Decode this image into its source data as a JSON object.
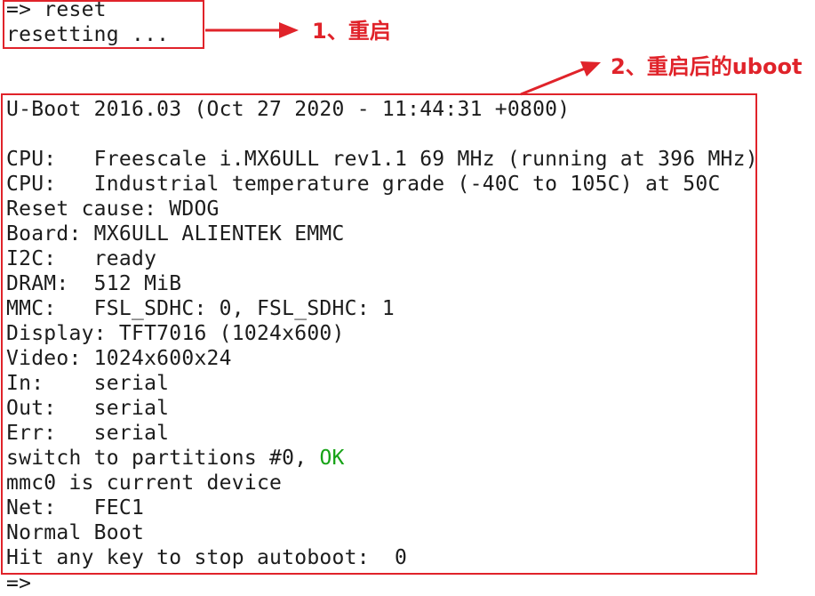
{
  "terminal": {
    "pre_reset": {
      "command": "=> reset",
      "resetting": "resetting ..."
    },
    "boot": {
      "version": "U-Boot 2016.03 (Oct 27 2020 - 11:44:31 +0800)",
      "cpu": "CPU:   Freescale i.MX6ULL rev1.1 69 MHz (running at 396 MHz)",
      "cpu_temp": "CPU:   Industrial temperature grade (-40C to 105C) at 50C",
      "reset_cause": "Reset cause: WDOG",
      "board": "Board: MX6ULL ALIENTEK EMMC",
      "i2c": "I2C:   ready",
      "dram": "DRAM:  512 MiB",
      "mmc": "MMC:   FSL_SDHC: 0, FSL_SDHC: 1",
      "display": "Display: TFT7016 (1024x600)",
      "video": "Video: 1024x600x24",
      "in": "In:    serial",
      "out": "Out:   serial",
      "err": "Err:   serial",
      "switch_prefix": "switch to partitions #0, ",
      "switch_ok": "OK",
      "mmc_current": "mmc0 is current device",
      "net": "Net:   FEC1",
      "normal_boot": "Normal Boot",
      "autoboot": "Hit any key to stop autoboot:  0"
    },
    "prompt": "=>"
  },
  "annotations": {
    "reset_note": "1、重启",
    "uboot_note": "2、重启后的uboot"
  },
  "colors": {
    "annotation_red": "#e0232a",
    "ok_green": "#17a317",
    "text": "#1c1c1c",
    "background": "#ffffff"
  }
}
